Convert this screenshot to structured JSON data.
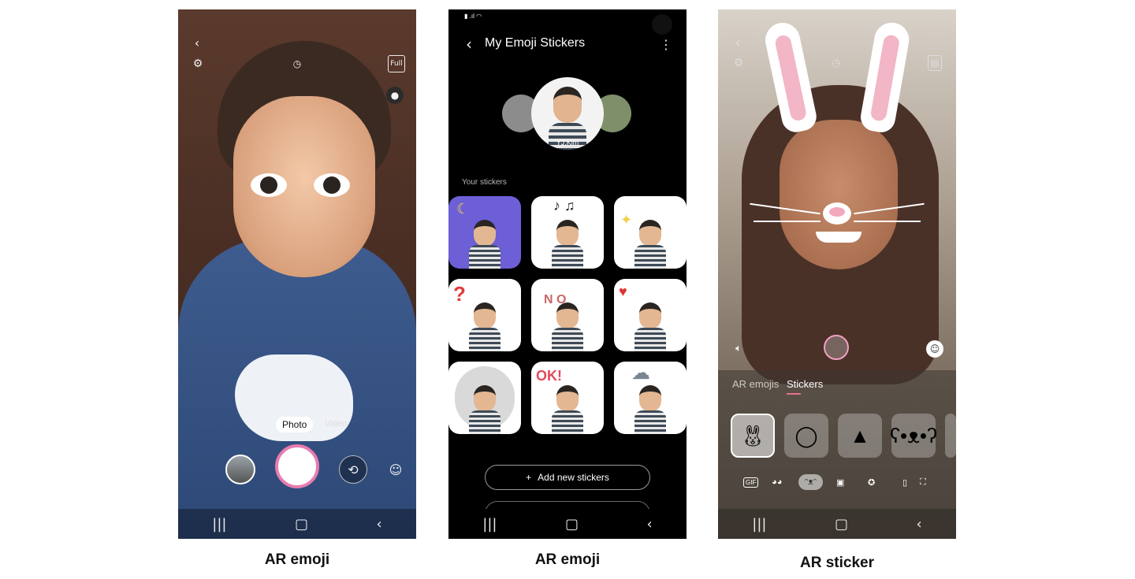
{
  "captions": [
    "AR emoji",
    "AR emoji",
    "AR sticker"
  ],
  "screen1": {
    "modes": {
      "active": "Photo",
      "next": "Video"
    },
    "flash_label": "Full"
  },
  "screen2": {
    "title": "My Emoji Stickers",
    "profile_name": "YJ.Kim",
    "section_label": "Your stickers",
    "add_button_label": "Add new stickers",
    "sticker_decorations": [
      "☾",
      "♪ ♫",
      "✦",
      "?",
      "N O",
      "♥",
      "",
      "OK!",
      "☁"
    ]
  },
  "screen3": {
    "tabs": [
      "AR emojis",
      "Stickers"
    ],
    "active_tab": "Stickers",
    "categories": [
      "GIF"
    ]
  },
  "colors": {
    "shutter_ring": "#e77cb0",
    "tab_accent": "#e76f90"
  }
}
